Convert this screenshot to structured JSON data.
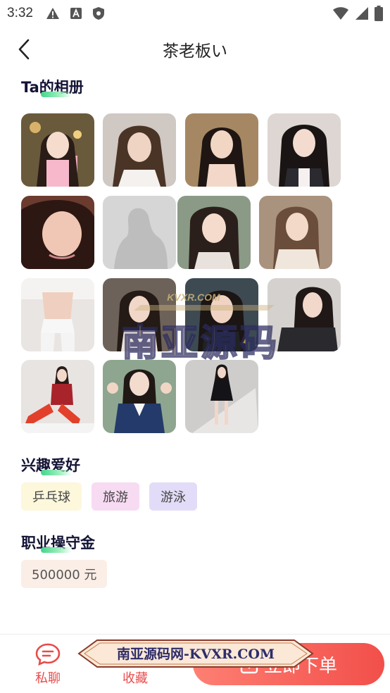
{
  "status_bar": {
    "time": "3:32"
  },
  "header": {
    "title": "茶老板い"
  },
  "album": {
    "title": "Ta的相册"
  },
  "hobbies": {
    "title": "兴趣爱好",
    "tags": [
      {
        "label": "乒乓球",
        "color": "#fdf7dc"
      },
      {
        "label": "旅游",
        "color": "#f7dbf3"
      },
      {
        "label": "游泳",
        "color": "#e2dcf8"
      }
    ]
  },
  "deposit": {
    "title": "职业操守金",
    "value": "500000 元"
  },
  "bottom_bar": {
    "chat_label": "私聊",
    "favorite_label": "收藏",
    "order_label": "立即下单"
  },
  "watermark": {
    "site_url": "KVXR.COM",
    "brand": "南亚源码",
    "banner_text": "南亚源码网-KVXR.COM"
  },
  "colors": {
    "accent": "#e84b4b",
    "order_gradient_start": "#fe7f73",
    "order_gradient_end": "#f24f4a",
    "title_dark": "#131335"
  }
}
